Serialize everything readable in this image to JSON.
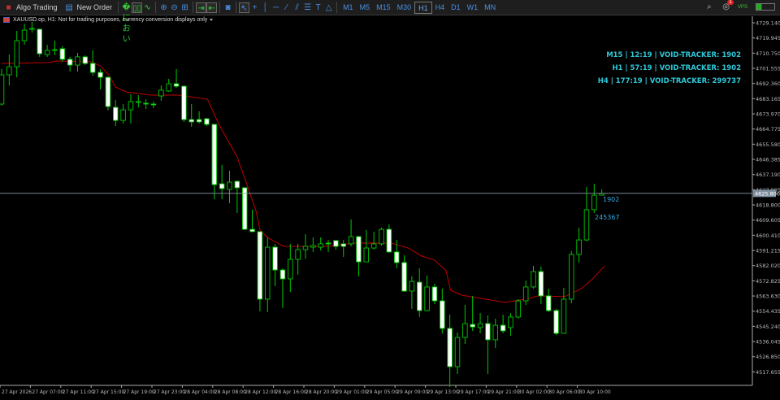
{
  "toolbar": {
    "algo_trading": "Algo Trading",
    "new_order": "New Order",
    "icons": [
      "bar-chart-icon",
      "candlestick-icon",
      "line-chart-icon",
      "zoom-in-icon",
      "zoom-out-icon",
      "tile-windows-icon",
      "autoscroll-icon",
      "chart-shift-icon",
      "screenshot-icon",
      "cursor-icon",
      "crosshair-icon",
      "vertical-line-icon",
      "horizontal-line-icon",
      "trendline-icon",
      "equidistant-channel-icon",
      "fibonacci-icon",
      "text-icon",
      "shapes-icon"
    ],
    "timeframes": [
      "M1",
      "M5",
      "M15",
      "M30",
      "H1",
      "H4",
      "D1",
      "W1",
      "MN"
    ],
    "active_timeframe": "H1",
    "notification_count": "1",
    "vps_label": "VPS"
  },
  "chart": {
    "title": "XAUUSD.op, H1:  Not for trading purposes, currency conversion displays only",
    "current_price": "4625.800",
    "overlay_lines": [
      "M15   | 12:19 | VOID-TRACKER: 1902",
      "H1   | 57:19 | VOID-TRACKER: 1902",
      "H4   | 177:19 | VOID-TRACKER: 299737"
    ],
    "label_1": "1902",
    "label_2": "245367",
    "colors": {
      "bull": "#00c800",
      "bear_fill": "#ffffff",
      "ma": "#c00000",
      "overlay": "#2ec8d8"
    }
  },
  "chart_data": {
    "type": "candlestick",
    "symbol": "XAUUSD.op",
    "timeframe": "H1",
    "ylim": [
      4513.0,
      4733.0
    ],
    "y_ticks": [
      "4729.140",
      "4719.945",
      "4710.750",
      "4701.555",
      "4692.360",
      "4683.165",
      "4673.970",
      "4664.775",
      "4655.580",
      "4646.385",
      "4637.190",
      "4627.995",
      "4618.800",
      "4609.605",
      "4600.410",
      "4591.215",
      "4582.020",
      "4572.825",
      "4563.630",
      "4554.435",
      "4545.240",
      "4536.045",
      "4526.850",
      "4517.655"
    ],
    "x_ticks": [
      "27 Apr 2026",
      "27 Apr 07:00",
      "27 Apr 11:00",
      "27 Apr 15:00",
      "27 Apr 19:00",
      "27 Apr 23:00",
      "28 Apr 04:00",
      "28 Apr 08:00",
      "28 Apr 12:00",
      "28 Apr 16:00",
      "28 Apr 20:00",
      "29 Apr 01:00",
      "29 Apr 05:00",
      "29 Apr 09:00",
      "29 Apr 13:00",
      "29 Apr 17:00",
      "29 Apr 21:00",
      "30 Apr 02:00",
      "30 Apr 06:00",
      "30 Apr 10:00"
    ],
    "x_tick_every": 4,
    "ohlc": [
      [
        4679.9,
        4701.1,
        4678.9,
        4697.6
      ],
      [
        4697.6,
        4709.9,
        4691.2,
        4702.5
      ],
      [
        4702.5,
        4724.2,
        4696.1,
        4718.3
      ],
      [
        4718.3,
        4728.6,
        4715.8,
        4724.7
      ],
      [
        4725.2,
        4729.6,
        4723.2,
        4725.7
      ],
      [
        4725.2,
        4725.7,
        4708.5,
        4710.4
      ],
      [
        4709.9,
        4715.8,
        4708.5,
        4712.4
      ],
      [
        4712.4,
        4718.3,
        4709.4,
        4712.9
      ],
      [
        4713.4,
        4714.9,
        4705.5,
        4707.0
      ],
      [
        4707.0,
        4708.5,
        4699.6,
        4703.5
      ],
      [
        4703.5,
        4710.9,
        4699.6,
        4708.5
      ],
      [
        4708.5,
        4709.4,
        4703.5,
        4704.5
      ],
      [
        4704.5,
        4712.4,
        4697.1,
        4699.1
      ],
      [
        4699.1,
        4701.1,
        4688.8,
        4696.1
      ],
      [
        4696.1,
        4696.6,
        4676.0,
        4678.4
      ],
      [
        4677.9,
        4682.4,
        4666.6,
        4670.0
      ],
      [
        4670.0,
        4679.9,
        4668.1,
        4676.4
      ],
      [
        4676.4,
        4685.8,
        4668.1,
        4681.4
      ],
      [
        4680.9,
        4685.3,
        4677.9,
        4681.4
      ],
      [
        4680.4,
        4682.8,
        4676.9,
        4679.9
      ],
      [
        4679.9,
        4681.4,
        4677.4,
        4679.4
      ],
      [
        4684.8,
        4691.2,
        4681.9,
        4688.3
      ],
      [
        4687.8,
        4695.2,
        4687.3,
        4692.2
      ],
      [
        4692.2,
        4701.1,
        4689.7,
        4690.7
      ],
      [
        4690.7,
        4691.2,
        4669.1,
        4670.5
      ],
      [
        4670.5,
        4679.9,
        4666.1,
        4669.1
      ],
      [
        4670.5,
        4675.5,
        4668.1,
        4669.1
      ],
      [
        4671.0,
        4671.5,
        4666.6,
        4667.6
      ],
      [
        4667.6,
        4667.6,
        4622.3,
        4631.1
      ],
      [
        4631.6,
        4643.0,
        4622.3,
        4628.7
      ],
      [
        4628.2,
        4639.5,
        4619.8,
        4632.6
      ],
      [
        4633.1,
        4633.6,
        4613.9,
        4629.2
      ],
      [
        4629.2,
        4629.2,
        4603.6,
        4604.0
      ],
      [
        4604.0,
        4615.9,
        4602.6,
        4602.6
      ],
      [
        4602.6,
        4602.6,
        4554.3,
        4561.7
      ],
      [
        4561.7,
        4599.1,
        4553.8,
        4593.2
      ],
      [
        4593.2,
        4595.2,
        4569.6,
        4579.4
      ],
      [
        4579.4,
        4580.4,
        4556.3,
        4574.0
      ],
      [
        4574.0,
        4595.2,
        4566.1,
        4585.8
      ],
      [
        4585.8,
        4595.2,
        4576.5,
        4591.7
      ],
      [
        4591.7,
        4601.1,
        4586.3,
        4593.7
      ],
      [
        4593.2,
        4599.1,
        4590.3,
        4594.2
      ],
      [
        4593.2,
        4599.1,
        4591.2,
        4595.2
      ],
      [
        4595.7,
        4597.6,
        4590.3,
        4595.2
      ],
      [
        4597.2,
        4597.2,
        4591.7,
        4593.7
      ],
      [
        4595.2,
        4597.6,
        4587.3,
        4593.7
      ],
      [
        4595.2,
        4610.0,
        4593.7,
        4599.6
      ],
      [
        4599.6,
        4600.1,
        4575.5,
        4584.3
      ],
      [
        4584.3,
        4603.6,
        4584.3,
        4592.7
      ],
      [
        4592.7,
        4602.6,
        4591.7,
        4595.2
      ],
      [
        4595.2,
        4605.0,
        4594.2,
        4604.0
      ],
      [
        4604.0,
        4607.0,
        4589.8,
        4590.3
      ],
      [
        4590.3,
        4597.6,
        4580.4,
        4583.9
      ],
      [
        4583.9,
        4588.3,
        4566.1,
        4566.6
      ],
      [
        4566.6,
        4575.5,
        4555.8,
        4572.5
      ],
      [
        4572.0,
        4580.4,
        4550.9,
        4554.8
      ],
      [
        4554.8,
        4576.0,
        4554.3,
        4569.1
      ],
      [
        4569.1,
        4571.1,
        4558.7,
        4560.7
      ],
      [
        4560.7,
        4568.1,
        4541.0,
        4544.0
      ],
      [
        4544.0,
        4552.3,
        4508.5,
        4520.8
      ],
      [
        4520.8,
        4541.5,
        4516.4,
        4538.5
      ],
      [
        4538.5,
        4558.2,
        4534.6,
        4546.9
      ],
      [
        4546.4,
        4563.7,
        4542.5,
        4544.9
      ],
      [
        4544.5,
        4553.3,
        4541.0,
        4546.9
      ],
      [
        4546.9,
        4551.8,
        4516.4,
        4537.1
      ],
      [
        4537.1,
        4549.9,
        4532.1,
        4545.9
      ],
      [
        4545.9,
        4552.3,
        4541.0,
        4542.5
      ],
      [
        4544.5,
        4553.3,
        4539.5,
        4550.9
      ],
      [
        4550.9,
        4561.7,
        4549.9,
        4560.7
      ],
      [
        4560.7,
        4573.0,
        4558.2,
        4569.1
      ],
      [
        4569.1,
        4581.9,
        4568.1,
        4578.4
      ],
      [
        4578.4,
        4581.4,
        4558.7,
        4563.7
      ],
      [
        4563.7,
        4568.1,
        4553.8,
        4554.8
      ],
      [
        4554.8,
        4555.8,
        4540.0,
        4541.0
      ],
      [
        4541.0,
        4568.6,
        4541.0,
        4561.7
      ],
      [
        4561.7,
        4590.8,
        4559.2,
        4588.8
      ],
      [
        4588.8,
        4605.0,
        4583.9,
        4597.6
      ],
      [
        4597.6,
        4629.7,
        4596.7,
        4615.9
      ],
      [
        4615.9,
        4631.6,
        4613.9,
        4624.7
      ],
      [
        4624.7,
        4628.2,
        4624.7,
        4625.7
      ]
    ],
    "moving_average": [
      [
        0,
        4704.5
      ],
      [
        6.1,
        4705.0
      ],
      [
        7.2,
        4706.0
      ],
      [
        11.8,
        4705.5
      ],
      [
        13.0,
        4703.0
      ],
      [
        14.1,
        4697.6
      ],
      [
        15.0,
        4690.2
      ],
      [
        16.4,
        4687.3
      ],
      [
        19.6,
        4685.3
      ],
      [
        23.2,
        4685.3
      ],
      [
        27.1,
        4682.8
      ],
      [
        28.6,
        4667.6
      ],
      [
        31.0,
        4647.9
      ],
      [
        32.4,
        4629.7
      ],
      [
        33.5,
        4614.9
      ],
      [
        34.0,
        4603.6
      ],
      [
        35.0,
        4599.1
      ],
      [
        37.1,
        4593.7
      ],
      [
        42.8,
        4593.7
      ],
      [
        46.3,
        4595.7
      ],
      [
        51.3,
        4595.7
      ],
      [
        53.5,
        4592.7
      ],
      [
        55.3,
        4587.8
      ],
      [
        57.0,
        4585.3
      ],
      [
        58.5,
        4579.0
      ],
      [
        59.1,
        4567.1
      ],
      [
        60.6,
        4564.1
      ],
      [
        63.1,
        4562.2
      ],
      [
        66.3,
        4559.7
      ],
      [
        69.5,
        4562.2
      ],
      [
        70.6,
        4563.7
      ],
      [
        74.1,
        4563.2
      ],
      [
        76.3,
        4568.1
      ],
      [
        77.8,
        4574.0
      ],
      [
        79.4,
        4581.9
      ]
    ],
    "current_price": 4625.8
  }
}
